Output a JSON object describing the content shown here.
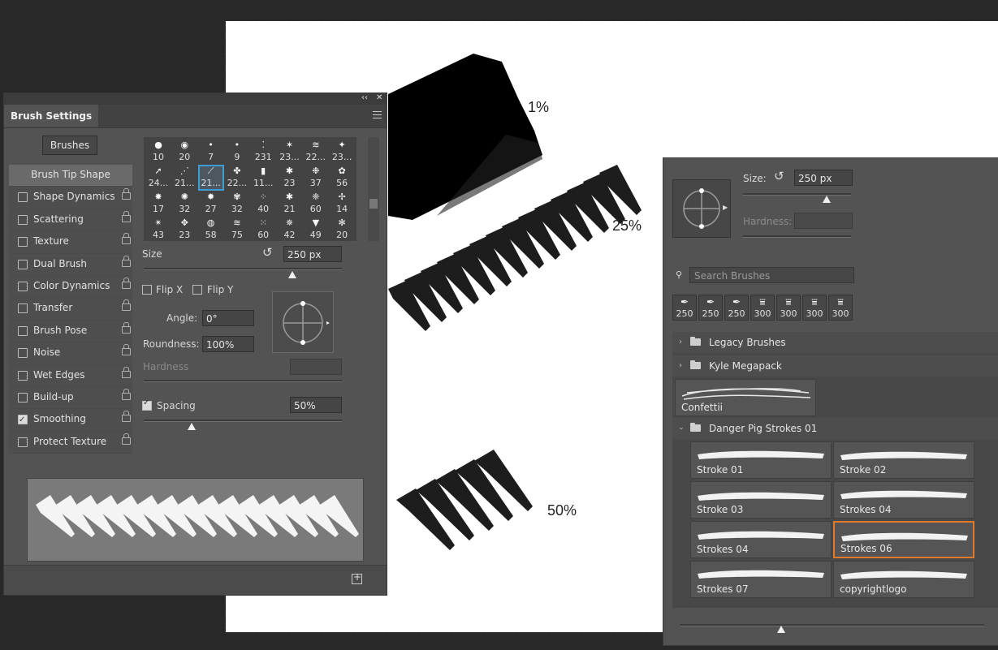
{
  "canvas": {
    "labels": [
      "1%",
      "25%",
      "50%"
    ]
  },
  "brush_settings": {
    "tab_title": "Brush Settings",
    "brushes_button": "Brushes",
    "options": [
      {
        "label": "Brush Tip Shape",
        "checkbox": null,
        "selected": true
      },
      {
        "label": "Shape Dynamics",
        "checkbox": false
      },
      {
        "label": "Scattering",
        "checkbox": false
      },
      {
        "label": "Texture",
        "checkbox": false
      },
      {
        "label": "Dual Brush",
        "checkbox": false
      },
      {
        "label": "Color Dynamics",
        "checkbox": false
      },
      {
        "label": "Transfer",
        "checkbox": false
      },
      {
        "label": "Brush Pose",
        "checkbox": false
      },
      {
        "label": "Noise",
        "checkbox": false
      },
      {
        "label": "Wet Edges",
        "checkbox": false
      },
      {
        "label": "Build-up",
        "checkbox": false
      },
      {
        "label": "Smoothing",
        "checkbox": true
      },
      {
        "label": "Protect Texture",
        "checkbox": false
      }
    ],
    "tip_numbers": [
      "10",
      "20",
      "7",
      "9",
      "231",
      "23...",
      "22...",
      "23...",
      "24...",
      "21...",
      "21...",
      "22...",
      "11...",
      "23",
      "37",
      "56",
      "17",
      "32",
      "27",
      "32",
      "40",
      "21",
      "60",
      "14",
      "43",
      "23",
      "58",
      "75",
      "60",
      "42",
      "49",
      "20"
    ],
    "selected_tip_index": 10,
    "size_label": "Size",
    "size_value": "250 px",
    "size_slider_fraction": 0.75,
    "flip_x_label": "Flip X",
    "flip_y_label": "Flip Y",
    "angle_label": "Angle:",
    "angle_value": "0°",
    "roundness_label": "Roundness:",
    "roundness_value": "100%",
    "hardness_label": "Hardness",
    "spacing_label": "Spacing",
    "spacing_checked": true,
    "spacing_value": "50%",
    "spacing_slider_fraction": 0.24
  },
  "brushes": {
    "size_label": "Size:",
    "size_value": "250 px",
    "hardness_label": "Hardness:",
    "search_placeholder": "Search Brushes",
    "recent": [
      "250",
      "250",
      "250",
      "300",
      "300",
      "300",
      "300"
    ],
    "groups": {
      "legacy": "Legacy Brushes",
      "kyle": "Kyle Megapack",
      "confetti": "Confettii",
      "danger": "Danger Pig Strokes 01"
    },
    "strokes": [
      "Stroke 01",
      "Stroke 02",
      "Stroke 03",
      "Strokes 04",
      "Strokes 04",
      "Strokes 06",
      "Strokes 07",
      "copyrightlogo"
    ],
    "selected_stroke_index": 5
  }
}
